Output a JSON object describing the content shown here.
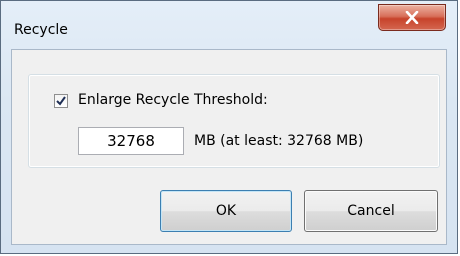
{
  "window": {
    "title": "Recycle",
    "close_icon": "close-x-icon"
  },
  "options": {
    "enlarge_checkbox_checked": true,
    "enlarge_label": "Enlarge Recycle Threshold:",
    "threshold_value": "32768",
    "threshold_hint": "MB (at least: 32768 MB)"
  },
  "buttons": {
    "ok_label": "OK",
    "cancel_label": "Cancel"
  },
  "colors": {
    "close_button": "#c7432b",
    "frame": "#d6e3f1",
    "client": "#f0f0f0"
  }
}
